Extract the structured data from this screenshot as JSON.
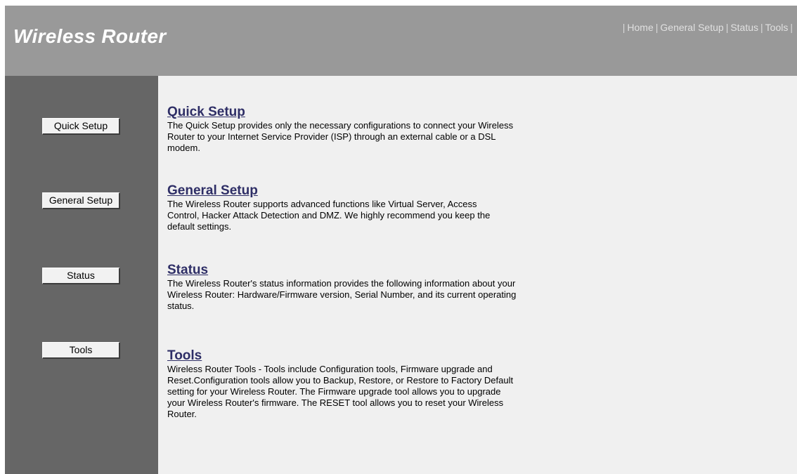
{
  "header": {
    "brand": "Wireless Router",
    "nav": [
      {
        "label": "Home"
      },
      {
        "label": "General Setup"
      },
      {
        "label": "Status"
      },
      {
        "label": "Tools"
      }
    ]
  },
  "sidebar": {
    "buttons": [
      {
        "label": "Quick Setup"
      },
      {
        "label": "General Setup"
      },
      {
        "label": "Status"
      },
      {
        "label": "Tools"
      }
    ]
  },
  "main": {
    "sections": [
      {
        "title": "Quick Setup",
        "desc": "The Quick Setup provides only the necessary configurations to connect your Wireless Router to your Internet Service Provider (ISP) through an external cable or a DSL modem."
      },
      {
        "title": "General Setup",
        "desc": "The Wireless Router supports advanced functions like Virtual Server, Access Control, Hacker Attack Detection and DMZ. We highly recommend you keep the default settings."
      },
      {
        "title": "Status",
        "desc": "The Wireless Router's status information provides the following information about your Wireless Router: Hardware/Firmware version, Serial Number, and its current operating status."
      },
      {
        "title": "Tools",
        "desc": "Wireless Router Tools - Tools include Configuration tools, Firmware upgrade and Reset.Configuration tools allow you to Backup, Restore, or Restore to Factory Default setting for your Wireless Router. The Firmware upgrade tool allows you to upgrade your Wireless Router's firmware. The RESET tool allows you to reset your Wireless Router."
      }
    ]
  }
}
